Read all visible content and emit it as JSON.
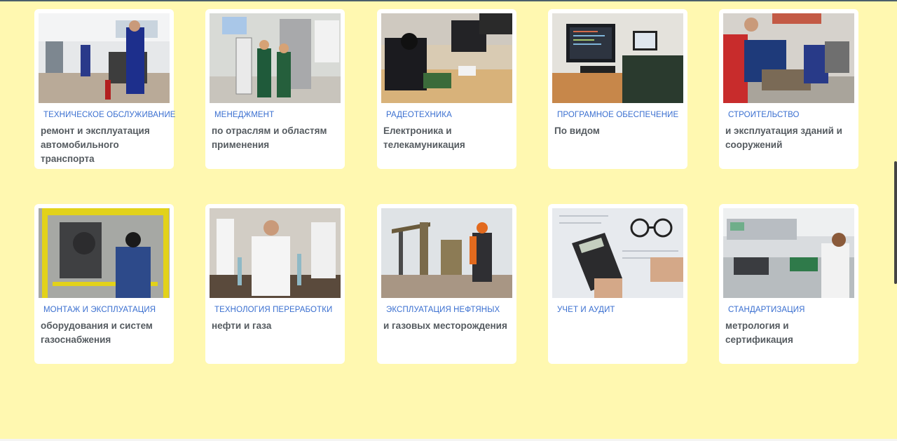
{
  "cards": [
    {
      "category": "ТЕХНИЧЕСКОЕ ОБСЛУЖИВАНИЕ",
      "description": "ремонт и эксплуатация автомобильного транспорта"
    },
    {
      "category": "МЕНЕДЖМЕНТ",
      "description": "по отраслям и областям применения"
    },
    {
      "category": "РАДЕОТЕХНИКА",
      "description": "Електроника и телекамуникация"
    },
    {
      "category": "ПРОГРАМНОЕ ОБЕСПЕЧЕНИЕ",
      "description": "По видом"
    },
    {
      "category": "СТРОИТЕЛЬСТВО",
      "description": "и эксплуатация зданий и сооружений"
    },
    {
      "category": "МОНТАЖ И ЭКСПЛУАТАЦИЯ",
      "description": "оборудования и систем газоснабжения"
    },
    {
      "category": "ТЕХНОЛОГИЯ ПЕРЕРАБОТКИ",
      "description": "нефти и газа"
    },
    {
      "category": "ЭКСПЛУАТАЦИЯ НЕФТЯНЫХ",
      "description": "и газовых месторождения"
    },
    {
      "category": "УЧЕТ И АУДИТ",
      "description": ""
    },
    {
      "category": "СТАНДАРТИЗАЦИЯ",
      "description": "метрология и сертификация"
    }
  ],
  "colors": {
    "background": "#fff8b0",
    "category": "#3a6fd0",
    "text": "#555b60"
  }
}
